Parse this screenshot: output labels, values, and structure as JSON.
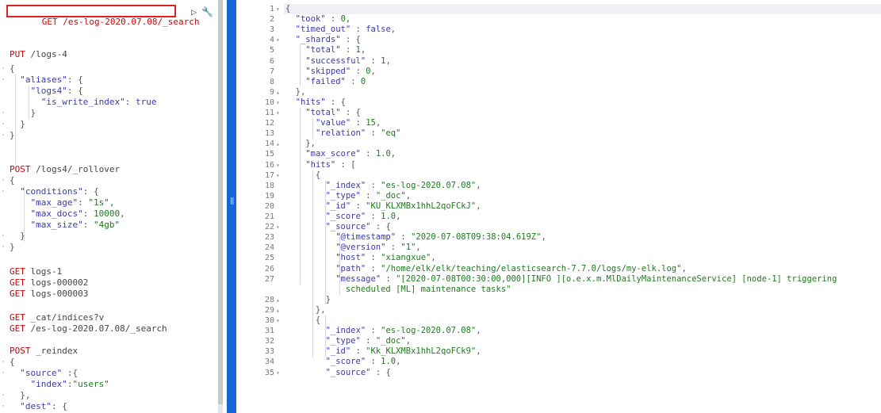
{
  "console": {
    "request_line": "GET /es-log-2020.07.08/_search",
    "request_method": "GET",
    "request_url": "/es-log-2020.07.08/_search",
    "run_icon": "play-icon",
    "settings_icon": "wrench-icon"
  },
  "editor_lines": [
    {
      "t": "PUT /logs-4",
      "kind": "req"
    },
    {
      "t": "{",
      "kind": "p"
    },
    {
      "t": "  \"aliases\": {",
      "kind": "code"
    },
    {
      "t": "    \"logs4\": {",
      "kind": "code"
    },
    {
      "t": "      \"is_write_index\": true",
      "kind": "code"
    },
    {
      "t": "    }",
      "kind": "p"
    },
    {
      "t": "  }",
      "kind": "p"
    },
    {
      "t": "}",
      "kind": "p"
    },
    {
      "t": "POST /logs4/_rollover",
      "kind": "req"
    },
    {
      "t": "{",
      "kind": "p"
    },
    {
      "t": "  \"conditions\": {",
      "kind": "code"
    },
    {
      "t": "    \"max_age\": \"1s\",",
      "kind": "code"
    },
    {
      "t": "    \"max_docs\": 10000,",
      "kind": "code"
    },
    {
      "t": "    \"max_size\": \"4gb\"",
      "kind": "code"
    },
    {
      "t": "  }",
      "kind": "p"
    },
    {
      "t": "}",
      "kind": "p"
    },
    {
      "t": "GET logs-1",
      "kind": "req"
    },
    {
      "t": "GET logs-000002",
      "kind": "req"
    },
    {
      "t": "GET logs-000003",
      "kind": "req"
    },
    {
      "t": "GET _cat/indices?v",
      "kind": "req"
    },
    {
      "t": "GET /es-log-2020.07.08/_search",
      "kind": "req"
    },
    {
      "t": "POST _reindex",
      "kind": "req"
    },
    {
      "t": "{",
      "kind": "p"
    },
    {
      "t": "  \"source\" :{",
      "kind": "code"
    },
    {
      "t": "    \"index\":\"users\"",
      "kind": "code"
    },
    {
      "t": "  },",
      "kind": "p"
    },
    {
      "t": "  \"dest\": {",
      "kind": "code"
    }
  ],
  "response_lines": [
    {
      "n": "1",
      "f": "▾",
      "t": "{"
    },
    {
      "n": "2",
      "f": "",
      "t": "  \"took\" : 0,"
    },
    {
      "n": "3",
      "f": "",
      "t": "  \"timed_out\" : false,"
    },
    {
      "n": "4",
      "f": "▾",
      "t": "  \"_shards\" : {"
    },
    {
      "n": "5",
      "f": "",
      "t": "    \"total\" : 1,"
    },
    {
      "n": "6",
      "f": "",
      "t": "    \"successful\" : 1,"
    },
    {
      "n": "7",
      "f": "",
      "t": "    \"skipped\" : 0,"
    },
    {
      "n": "8",
      "f": "",
      "t": "    \"failed\" : 0"
    },
    {
      "n": "9",
      "f": "▴",
      "t": "  },"
    },
    {
      "n": "10",
      "f": "▾",
      "t": "  \"hits\" : {"
    },
    {
      "n": "11",
      "f": "▾",
      "t": "    \"total\" : {"
    },
    {
      "n": "12",
      "f": "",
      "t": "      \"value\" : 15,"
    },
    {
      "n": "13",
      "f": "",
      "t": "      \"relation\" : \"eq\""
    },
    {
      "n": "14",
      "f": "▴",
      "t": "    },"
    },
    {
      "n": "15",
      "f": "",
      "t": "    \"max_score\" : 1.0,"
    },
    {
      "n": "16",
      "f": "▾",
      "t": "    \"hits\" : ["
    },
    {
      "n": "17",
      "f": "▾",
      "t": "      {"
    },
    {
      "n": "18",
      "f": "",
      "t": "        \"_index\" : \"es-log-2020.07.08\","
    },
    {
      "n": "19",
      "f": "",
      "t": "        \"_type\" : \"_doc\","
    },
    {
      "n": "20",
      "f": "",
      "t": "        \"_id\" : \"KU_KLXMBx1hhL2qoFCkJ\","
    },
    {
      "n": "21",
      "f": "",
      "t": "        \"_score\" : 1.0,"
    },
    {
      "n": "22",
      "f": "▾",
      "t": "        \"_source\" : {"
    },
    {
      "n": "23",
      "f": "",
      "t": "          \"@timestamp\" : \"2020-07-08T09:38:04.619Z\","
    },
    {
      "n": "24",
      "f": "",
      "t": "          \"@version\" : \"1\","
    },
    {
      "n": "25",
      "f": "",
      "t": "          \"host\" : \"xiangxue\","
    },
    {
      "n": "26",
      "f": "",
      "t": "          \"path\" : \"/home/elk/elk/teaching/elasticsearch-7.7.0/logs/my-elk.log\","
    },
    {
      "n": "27",
      "f": "",
      "t": "          \"message\" : \"[2020-07-08T00:30:00,000][INFO ][o.e.x.m.MlDailyMaintenanceService] [node-1] triggering"
    },
    {
      "n": "",
      "f": "",
      "t": "            scheduled [ML] maintenance tasks\""
    },
    {
      "n": "28",
      "f": "▴",
      "t": "        }"
    },
    {
      "n": "29",
      "f": "▴",
      "t": "      },"
    },
    {
      "n": "30",
      "f": "▾",
      "t": "      {"
    },
    {
      "n": "31",
      "f": "",
      "t": "        \"_index\" : \"es-log-2020.07.08\","
    },
    {
      "n": "32",
      "f": "",
      "t": "        \"_type\" : \"_doc\","
    },
    {
      "n": "33",
      "f": "",
      "t": "        \"_id\" : \"Kk_KLXMBx1hhL2qoFCk9\","
    },
    {
      "n": "34",
      "f": "",
      "t": "        \"_score\" : 1.0,"
    },
    {
      "n": "35",
      "f": "▾",
      "t": "        \"_source\" : {"
    }
  ]
}
